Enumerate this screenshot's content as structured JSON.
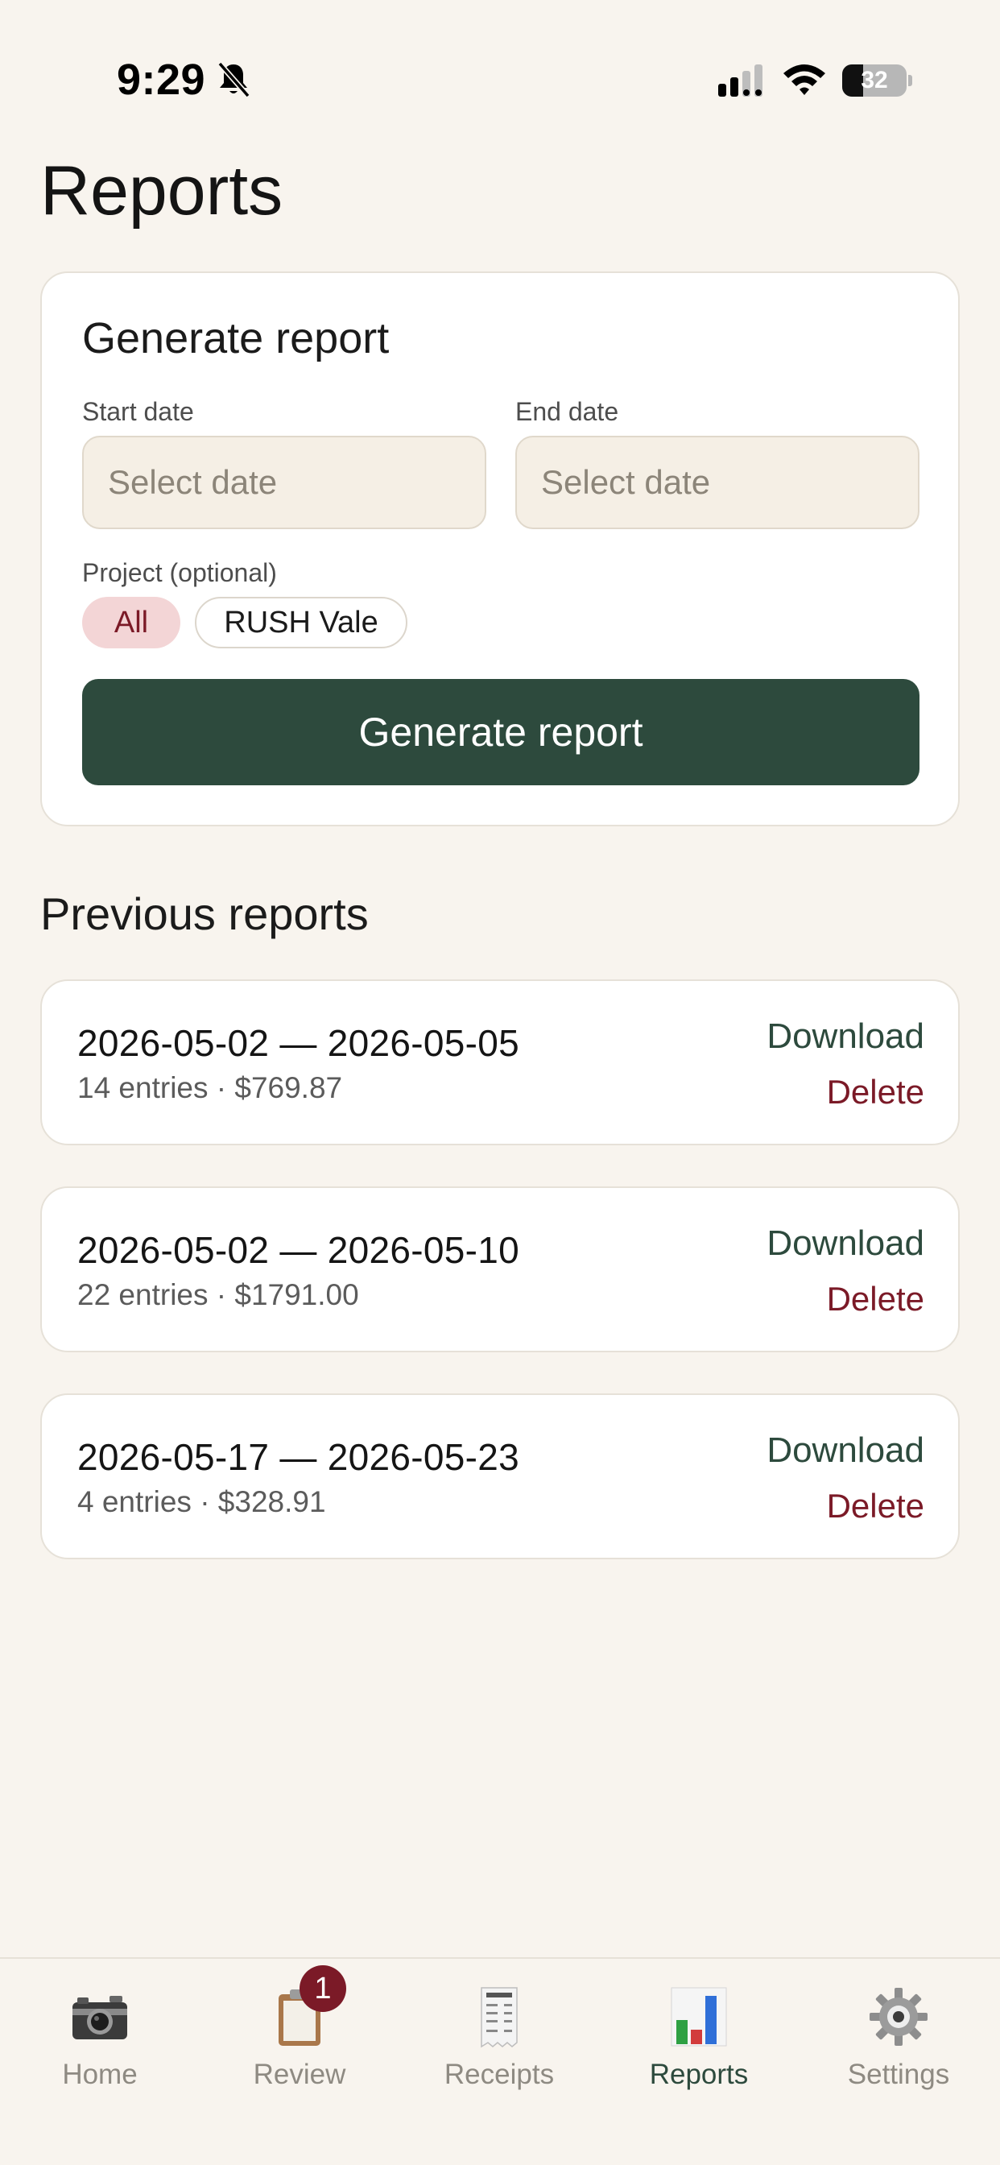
{
  "status_bar": {
    "time": "9:29",
    "battery_percent": "32"
  },
  "page": {
    "title": "Reports"
  },
  "generate": {
    "title": "Generate report",
    "start_label": "Start date",
    "start_placeholder": "Select date",
    "end_label": "End date",
    "end_placeholder": "Select date",
    "project_label": "Project (optional)",
    "projects": [
      {
        "label": "All",
        "selected": true
      },
      {
        "label": "RUSH Vale",
        "selected": false
      }
    ],
    "button_label": "Generate report"
  },
  "previous": {
    "title": "Previous reports",
    "reports": [
      {
        "range": "2026-05-02 — 2026-05-05",
        "meta": "14 entries · $769.87",
        "download": "Download",
        "delete": "Delete"
      },
      {
        "range": "2026-05-02 — 2026-05-10",
        "meta": "22 entries · $1791.00",
        "download": "Download",
        "delete": "Delete"
      },
      {
        "range": "2026-05-17 — 2026-05-23",
        "meta": "4 entries · $328.91",
        "download": "Download",
        "delete": "Delete"
      }
    ]
  },
  "tabs": [
    {
      "label": "Home",
      "icon": "camera-icon",
      "active": false
    },
    {
      "label": "Review",
      "icon": "clipboard-icon",
      "active": false,
      "badge": "1"
    },
    {
      "label": "Receipts",
      "icon": "receipt-icon",
      "active": false
    },
    {
      "label": "Reports",
      "icon": "bar-chart-icon",
      "active": true
    },
    {
      "label": "Settings",
      "icon": "gear-icon",
      "active": false
    }
  ],
  "colors": {
    "background": "#f8f4ee",
    "primary": "#2d4a3d",
    "danger": "#7b1a27",
    "chip_selected": "#f3d5d6"
  }
}
